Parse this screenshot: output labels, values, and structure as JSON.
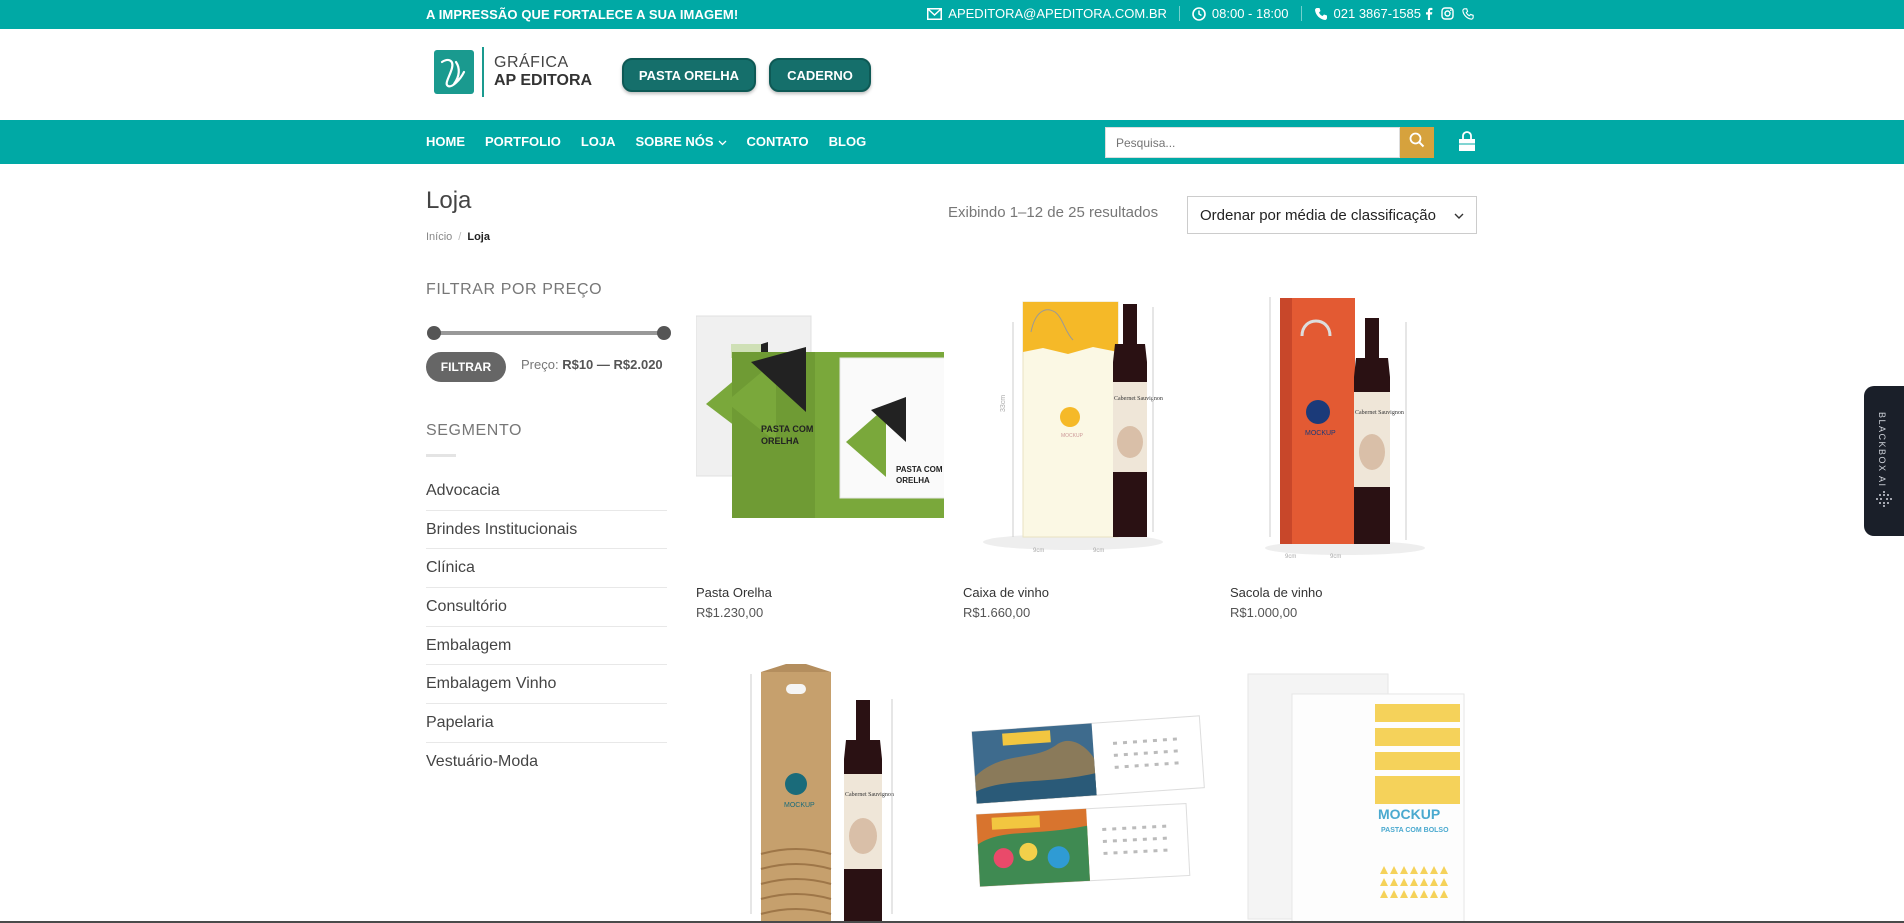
{
  "topbar": {
    "tagline": "A IMPRESSÃO QUE FORTALECE A SUA IMAGEM!",
    "email": "APEDITORA@APEDITORA.COM.BR",
    "hours": "08:00 - 18:00",
    "phone": "021 3867-1585",
    "social_icons": [
      "facebook-icon",
      "instagram-icon",
      "phone-icon"
    ]
  },
  "header": {
    "logo_line1": "GRÁFICA",
    "logo_line2": "AP EDITORA",
    "buttons": [
      "PASTA ORELHA",
      "CADERNO"
    ]
  },
  "nav": {
    "items": [
      "HOME",
      "PORTFOLIO",
      "LOJA",
      "SOBRE NÓS",
      "CONTATO",
      "BLOG"
    ],
    "search_placeholder": "Pesquisa...",
    "accent": "#00a9a5",
    "search_button_color": "#d6a23d"
  },
  "page": {
    "title": "Loja",
    "breadcrumb": [
      "Início",
      "Loja"
    ],
    "results": "Exibindo 1–12 de 25 resultados",
    "orderby": "Ordenar por média de classificação"
  },
  "sidebar": {
    "price_filter_title": "FILTRAR POR PREÇO",
    "filter_button": "FILTRAR",
    "price_label": "Preço:",
    "price_range": "R$10 — R$2.020",
    "segment_title": "SEGMENTO",
    "segments": [
      "Advocacia",
      "Brindes Institucionais",
      "Clínica",
      "Consultório",
      "Embalagem",
      "Embalagem Vinho",
      "Papelaria",
      "Vestuário-Moda"
    ]
  },
  "products": [
    {
      "name": "Pasta Orelha",
      "price": "R$1.230,00",
      "image_text": [
        "PASTA COM",
        "ORELHA"
      ]
    },
    {
      "name": "Caixa de vinho",
      "price": "R$1.660,00",
      "image_text": [
        "Cabernet Sauvignon"
      ]
    },
    {
      "name": "Sacola de vinho",
      "price": "R$1.000,00",
      "image_text": [
        "MOCKUP",
        "Cabernet Sauvignon"
      ]
    },
    {
      "name": "",
      "price": "",
      "image_text": [
        "MOCKUP",
        "Cabernet Sauvignon"
      ]
    },
    {
      "name": "",
      "price": "",
      "image_text": []
    },
    {
      "name": "",
      "price": "",
      "image_text": [
        "MOCKUP",
        "PASTA COM BOLSO"
      ]
    }
  ],
  "blackbox": {
    "label": "BLACKBOX AI"
  }
}
